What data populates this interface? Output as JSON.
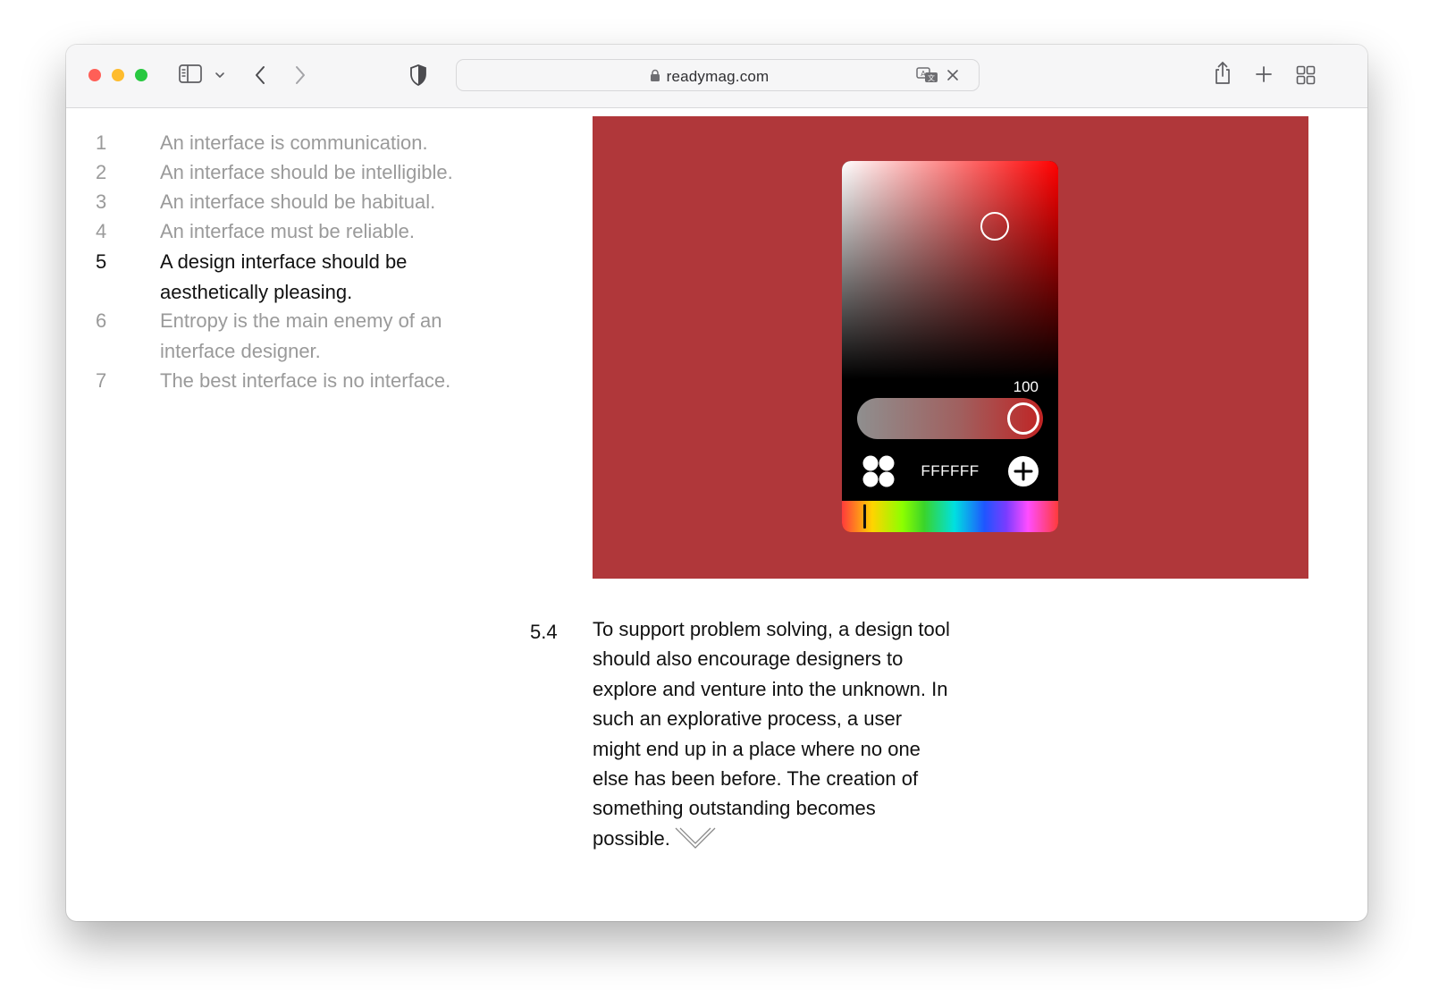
{
  "browser": {
    "url": "readymag.com",
    "colors": {
      "close": "#ff5f57",
      "minimize": "#febc2e",
      "maximize": "#28c840"
    },
    "icons": [
      "sidebar-icon",
      "chevron-down-icon",
      "back-icon",
      "forward-icon",
      "shield-icon",
      "lock-icon",
      "translate-icon",
      "clear-icon",
      "share-icon",
      "new-tab-icon",
      "tab-overview-icon"
    ]
  },
  "tenets": [
    {
      "num": "1",
      "text": "An interface is communication."
    },
    {
      "num": "2",
      "text": "An interface should be intelligible."
    },
    {
      "num": "3",
      "text": "An interface should be habitual."
    },
    {
      "num": "4",
      "text": "An interface must be reliable."
    },
    {
      "num": "5",
      "text": "A design interface should be aesthetically pleasing."
    },
    {
      "num": "6",
      "text": "Entropy is the main enemy of an interface designer."
    },
    {
      "num": "7",
      "text": "The best interface is no interface."
    }
  ],
  "active_tenet": "5",
  "hero": {
    "background": "#b0373a",
    "picker": {
      "opacity_value": "100",
      "hex_value": "FFFFFF",
      "hue": "red"
    }
  },
  "section": {
    "number": "5.4",
    "text": "To support problem solving, a design tool should also encourage designers to explore and venture into the unknown. In such an explorative process, a user might end up in a place where no one else has been before. The creation of something outstanding becomes possible."
  }
}
